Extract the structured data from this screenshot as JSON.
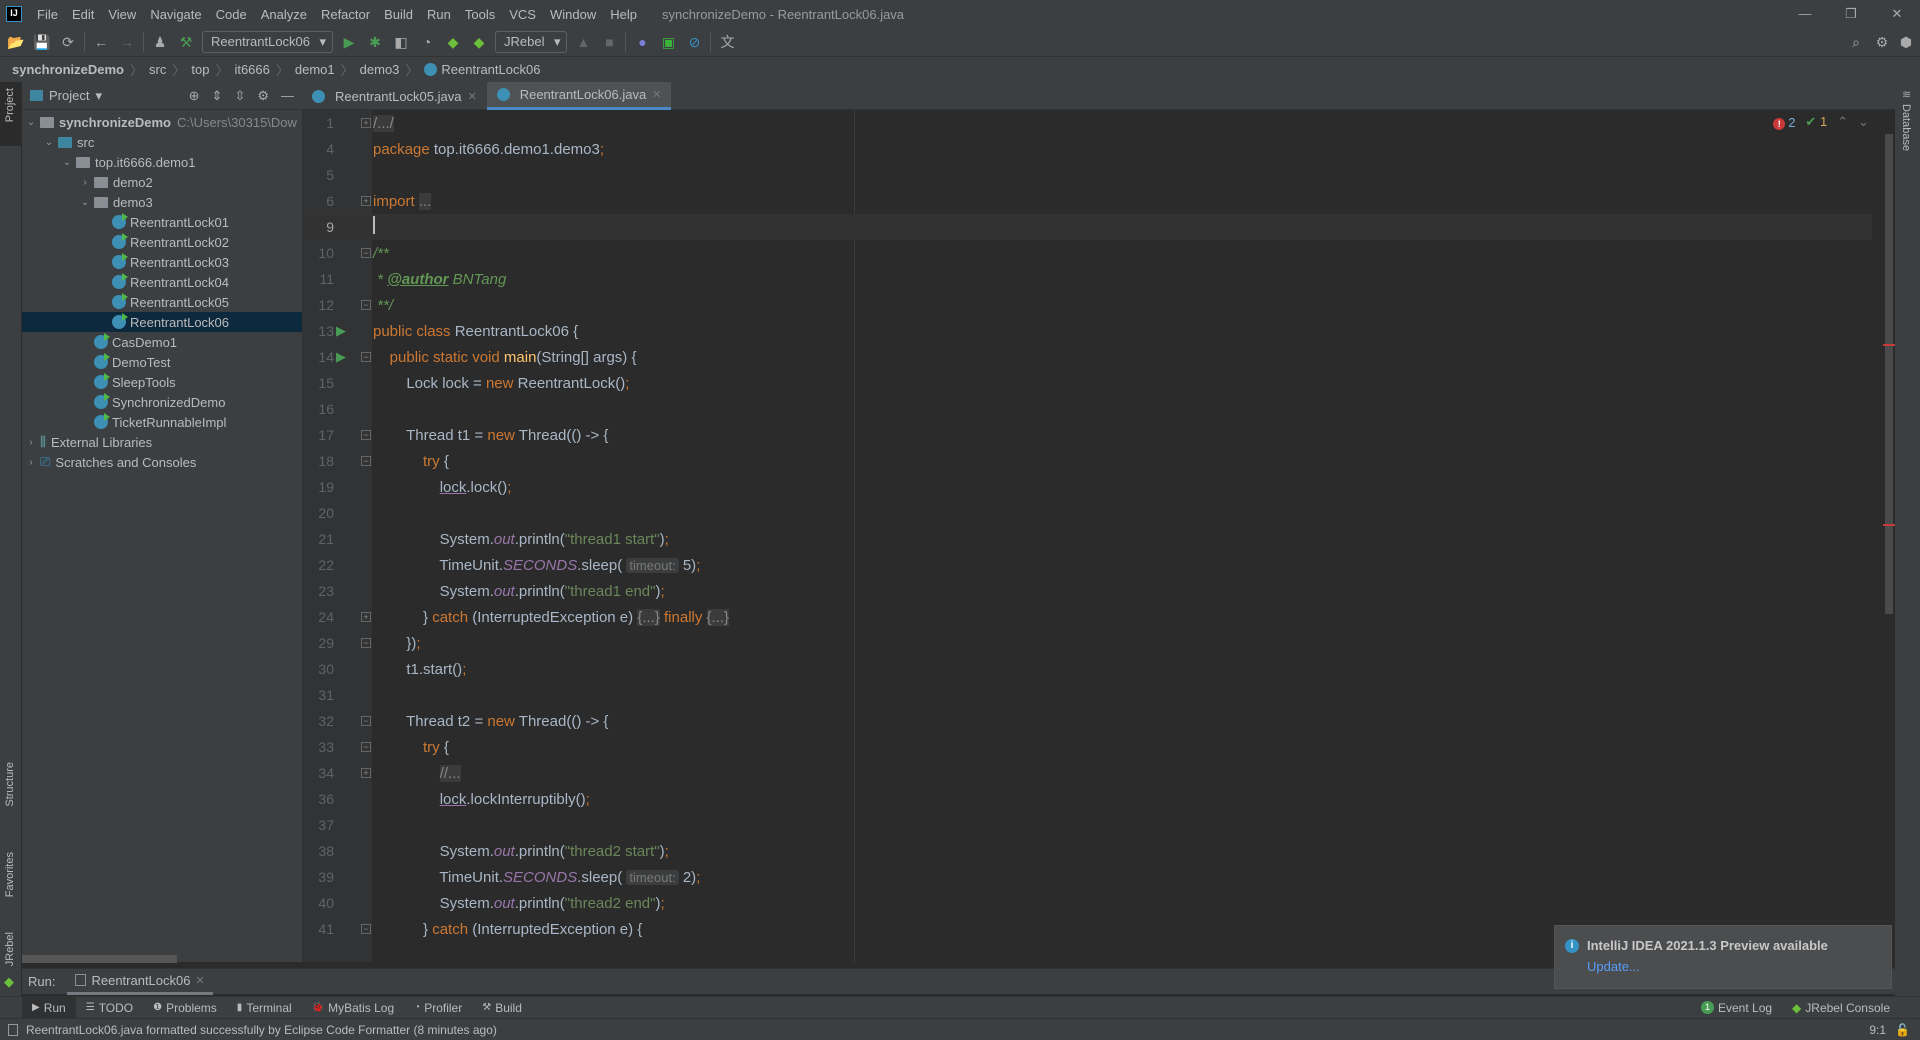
{
  "window": {
    "title": "synchronizeDemo - ReentrantLock06.java",
    "logo": "IJ"
  },
  "menu": [
    "File",
    "Edit",
    "View",
    "Navigate",
    "Code",
    "Analyze",
    "Refactor",
    "Build",
    "Run",
    "Tools",
    "VCS",
    "Window",
    "Help"
  ],
  "toolbar": {
    "run_config": "ReentrantLock06",
    "jrebel": "JRebel"
  },
  "breadcrumb": [
    "synchronizeDemo",
    "src",
    "top",
    "it6666",
    "demo1",
    "demo3",
    "ReentrantLock06"
  ],
  "project": {
    "header": "Project",
    "side_label": "Project",
    "tree": [
      {
        "label": "synchronizeDemo",
        "extra": "C:\\Users\\30315\\Dow",
        "depth": 0,
        "arrow": "open",
        "icon": "module",
        "bold": true
      },
      {
        "label": "src",
        "depth": 1,
        "arrow": "open",
        "icon": "source-folder"
      },
      {
        "label": "top.it6666.demo1",
        "depth": 2,
        "arrow": "open",
        "icon": "package"
      },
      {
        "label": "demo2",
        "depth": 3,
        "arrow": "closed",
        "icon": "package"
      },
      {
        "label": "demo3",
        "depth": 3,
        "arrow": "open",
        "icon": "package"
      },
      {
        "label": "ReentrantLock01",
        "depth": 4,
        "icon": "class"
      },
      {
        "label": "ReentrantLock02",
        "depth": 4,
        "icon": "class"
      },
      {
        "label": "ReentrantLock03",
        "depth": 4,
        "icon": "class"
      },
      {
        "label": "ReentrantLock04",
        "depth": 4,
        "icon": "class"
      },
      {
        "label": "ReentrantLock05",
        "depth": 4,
        "icon": "class"
      },
      {
        "label": "ReentrantLock06",
        "depth": 4,
        "icon": "class",
        "selected": true
      },
      {
        "label": "CasDemo1",
        "depth": 3,
        "icon": "class"
      },
      {
        "label": "DemoTest",
        "depth": 3,
        "icon": "class"
      },
      {
        "label": "SleepTools",
        "depth": 3,
        "icon": "class"
      },
      {
        "label": "SynchronizedDemo",
        "depth": 3,
        "icon": "class"
      },
      {
        "label": "TicketRunnableImpl",
        "depth": 3,
        "icon": "class"
      },
      {
        "label": "External Libraries",
        "depth": 0,
        "arrow": "closed",
        "icon": "libraries"
      },
      {
        "label": "Scratches and Consoles",
        "depth": 0,
        "arrow": "closed",
        "icon": "scratches"
      }
    ]
  },
  "left_stripe": [
    "Structure",
    "Favorites",
    "JRebel"
  ],
  "right_stripe": "Database",
  "tabs": [
    {
      "label": "ReentrantLock05.java",
      "active": false
    },
    {
      "label": "ReentrantLock06.java",
      "active": true
    }
  ],
  "inspections": {
    "errors": "2",
    "warnings": "1"
  },
  "editor": {
    "lines": [
      {
        "n": "1",
        "fold": "+",
        "t": [
          [
            "/.../",
            "fb"
          ]
        ]
      },
      {
        "n": "4",
        "t": [
          [
            "package ",
            "kw"
          ],
          [
            "top.it6666.demo1.demo3",
            ""
          ],
          [
            ";",
            "kw"
          ]
        ]
      },
      {
        "n": "5",
        "t": []
      },
      {
        "n": "6",
        "fold": "+",
        "t": [
          [
            "import ",
            "kw"
          ],
          [
            "...",
            "fb"
          ]
        ]
      },
      {
        "n": "9",
        "cur": true,
        "t": []
      },
      {
        "n": "10",
        "fold": "-",
        "t": [
          [
            "/**",
            "cm"
          ]
        ]
      },
      {
        "n": "11",
        "t": [
          [
            " * ",
            "cm"
          ],
          [
            "@author",
            "cmtag"
          ],
          [
            " BNTang",
            "cm"
          ]
        ]
      },
      {
        "n": "12",
        "fold": "-",
        "t": [
          [
            " **/",
            "cm"
          ]
        ]
      },
      {
        "n": "13",
        "run": true,
        "t": [
          [
            "public class ",
            "kw"
          ],
          [
            "ReentrantLock06 {",
            ""
          ]
        ]
      },
      {
        "n": "14",
        "run": true,
        "fold": "-",
        "t": [
          [
            "    public static void ",
            "kw"
          ],
          [
            "main",
            "fn"
          ],
          [
            "(String[] args) {",
            ""
          ]
        ]
      },
      {
        "n": "15",
        "t": [
          [
            "        Lock lock = ",
            ""
          ],
          [
            "new ",
            "kw"
          ],
          [
            "ReentrantLock()",
            ""
          ],
          [
            ";",
            "kw"
          ]
        ]
      },
      {
        "n": "16",
        "t": []
      },
      {
        "n": "17",
        "fold": "-",
        "t": [
          [
            "        Thread t1 = ",
            ""
          ],
          [
            "new ",
            "kw"
          ],
          [
            "Thread(() -> {",
            ""
          ]
        ]
      },
      {
        "n": "18",
        "fold": "-",
        "t": [
          [
            "            try ",
            "kw"
          ],
          [
            "{",
            ""
          ]
        ]
      },
      {
        "n": "19",
        "t": [
          [
            "                ",
            ""
          ],
          [
            "lock",
            "ul"
          ],
          [
            ".lock()",
            ""
          ],
          [
            ";",
            "kw"
          ]
        ]
      },
      {
        "n": "20",
        "t": []
      },
      {
        "n": "21",
        "t": [
          [
            "                System.",
            ""
          ],
          [
            "out",
            "fld"
          ],
          [
            ".println(",
            ""
          ],
          [
            "\"thread1 start\"",
            "str"
          ],
          [
            ")",
            ""
          ],
          [
            ";",
            "kw"
          ]
        ]
      },
      {
        "n": "22",
        "t": [
          [
            "                TimeUnit.",
            ""
          ],
          [
            "SECONDS",
            "fld"
          ],
          [
            ".sleep( ",
            ""
          ],
          [
            "timeout:",
            "hint"
          ],
          [
            " 5)",
            ""
          ],
          [
            ";",
            "kw"
          ]
        ]
      },
      {
        "n": "23",
        "t": [
          [
            "                System.",
            ""
          ],
          [
            "out",
            "fld"
          ],
          [
            ".println(",
            ""
          ],
          [
            "\"thread1 end\"",
            "str"
          ],
          [
            ")",
            ""
          ],
          [
            ";",
            "kw"
          ]
        ]
      },
      {
        "n": "24",
        "fold": "+",
        "t": [
          [
            "            } ",
            ""
          ],
          [
            "catch ",
            "kw"
          ],
          [
            "(InterruptedException e) ",
            ""
          ],
          [
            "{...}",
            "fb"
          ],
          [
            " finally ",
            "kw"
          ],
          [
            "{...}",
            "fb"
          ]
        ]
      },
      {
        "n": "29",
        "fold": "-",
        "t": [
          [
            "        })",
            ""
          ],
          [
            ";",
            "kw"
          ]
        ]
      },
      {
        "n": "30",
        "t": [
          [
            "        t1.start()",
            ""
          ],
          [
            ";",
            "kw"
          ]
        ]
      },
      {
        "n": "31",
        "t": []
      },
      {
        "n": "32",
        "fold": "-",
        "t": [
          [
            "        Thread t2 = ",
            ""
          ],
          [
            "new ",
            "kw"
          ],
          [
            "Thread(() -> {",
            ""
          ]
        ]
      },
      {
        "n": "33",
        "fold": "-",
        "t": [
          [
            "            try ",
            "kw"
          ],
          [
            "{",
            ""
          ]
        ]
      },
      {
        "n": "34",
        "fold": "+",
        "t": [
          [
            "                ",
            ""
          ],
          [
            "//...",
            "fb"
          ]
        ]
      },
      {
        "n": "36",
        "t": [
          [
            "                ",
            ""
          ],
          [
            "lock",
            "ul"
          ],
          [
            ".lockInterruptibly()",
            ""
          ],
          [
            ";",
            "kw"
          ]
        ]
      },
      {
        "n": "37",
        "t": []
      },
      {
        "n": "38",
        "t": [
          [
            "                System.",
            ""
          ],
          [
            "out",
            "fld"
          ],
          [
            ".println(",
            ""
          ],
          [
            "\"thread2 start\"",
            "str"
          ],
          [
            ")",
            ""
          ],
          [
            ";",
            "kw"
          ]
        ]
      },
      {
        "n": "39",
        "t": [
          [
            "                TimeUnit.",
            ""
          ],
          [
            "SECONDS",
            "fld"
          ],
          [
            ".sleep( ",
            ""
          ],
          [
            "timeout:",
            "hint"
          ],
          [
            " 2)",
            ""
          ],
          [
            ";",
            "kw"
          ]
        ]
      },
      {
        "n": "40",
        "t": [
          [
            "                System.",
            ""
          ],
          [
            "out",
            "fld"
          ],
          [
            ".println(",
            ""
          ],
          [
            "\"thread2 end\"",
            "str"
          ],
          [
            ")",
            ""
          ],
          [
            ";",
            "kw"
          ]
        ]
      },
      {
        "n": "41",
        "fold": "-",
        "t": [
          [
            "            } ",
            ""
          ],
          [
            "catch ",
            "kw"
          ],
          [
            "(InterruptedException e) {",
            ""
          ]
        ]
      }
    ]
  },
  "run_panel": {
    "label": "Run:",
    "tab": "ReentrantLock06"
  },
  "tool_tabs": [
    "Run",
    "TODO",
    "Problems",
    "Terminal",
    "MyBatis Log",
    "Profiler",
    "Build"
  ],
  "tool_tabs_right": [
    {
      "label": "Event Log",
      "badge": "1"
    },
    {
      "label": "JRebel Console"
    }
  ],
  "status": {
    "message": "ReentrantLock06.java formatted successfully by Eclipse Code Formatter (8 minutes ago)",
    "position": "9:1"
  },
  "notification": {
    "title": "IntelliJ IDEA 2021.1.3 Preview available",
    "link": "Update..."
  },
  "colors": {
    "accent": "#4a88c7",
    "keyword": "#cc7832",
    "string": "#6a8759",
    "selection": "#0d293e"
  }
}
